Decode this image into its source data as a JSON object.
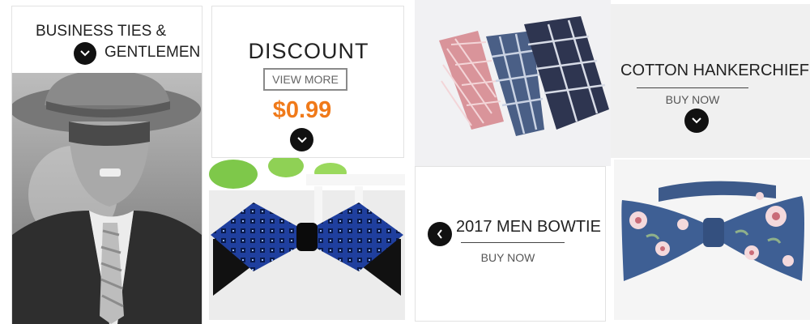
{
  "panel1": {
    "title_line1": "BUSINESS TIES &",
    "title_line2": "GENTLEMEN"
  },
  "panel2": {
    "title": "DISCOUNT",
    "button": "VIEW MORE",
    "price": "$0.99"
  },
  "panel4": {
    "title": "COTTON HANKERCHIEF",
    "link": "BUY NOW"
  },
  "panel6": {
    "title": "2017 MEN BOWTIE",
    "link": "BUY NOW"
  },
  "icons": {
    "down": "chevron-down-icon",
    "left": "chevron-left-icon"
  },
  "colors": {
    "price": "#f07a1a",
    "circle": "#111111",
    "tie_blue": "#1f3f9e"
  }
}
